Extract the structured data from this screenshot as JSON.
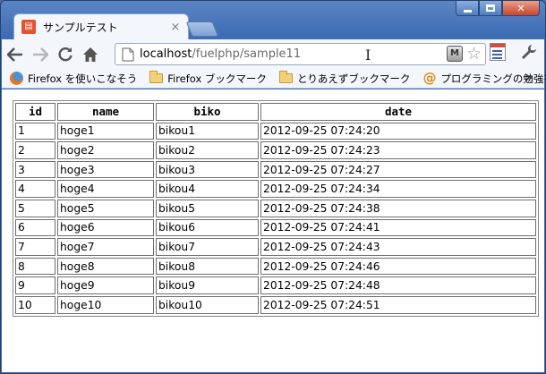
{
  "window": {
    "tab_title": "サンプルテスト",
    "tab_favicon_glyph": "▤",
    "tab_close_glyph": "×",
    "caption": {
      "minimize": "",
      "maximize": "",
      "close": "✕"
    }
  },
  "toolbar": {
    "url_host": "localhost",
    "url_path": "/fuelphp/sample11",
    "ext_label": "M",
    "star_glyph": "☆",
    "wrench_glyph": "🔧"
  },
  "bookmarks": {
    "items": [
      {
        "label": "Firefox を使いこなそう",
        "icon": "firefox-icon"
      },
      {
        "label": "Firefox ブックマーク",
        "icon": "folder-icon"
      },
      {
        "label": "とりあえずブックマーク",
        "icon": "folder-icon"
      },
      {
        "label": "プログラミングの勉強を…",
        "icon": "at-icon"
      }
    ],
    "more": "»"
  },
  "table": {
    "headers": [
      "id",
      "name",
      "biko",
      "date"
    ],
    "rows": [
      [
        "1",
        "hoge1",
        "bikou1",
        "2012-09-25 07:24:20"
      ],
      [
        "2",
        "hoge2",
        "bikou2",
        "2012-09-25 07:24:23"
      ],
      [
        "3",
        "hoge3",
        "bikou3",
        "2012-09-25 07:24:27"
      ],
      [
        "4",
        "hoge4",
        "bikou4",
        "2012-09-25 07:24:34"
      ],
      [
        "5",
        "hoge5",
        "bikou5",
        "2012-09-25 07:24:38"
      ],
      [
        "6",
        "hoge6",
        "bikou6",
        "2012-09-25 07:24:41"
      ],
      [
        "7",
        "hoge7",
        "bikou7",
        "2012-09-25 07:24:43"
      ],
      [
        "8",
        "hoge8",
        "bikou8",
        "2012-09-25 07:24:46"
      ],
      [
        "9",
        "hoge9",
        "bikou9",
        "2012-09-25 07:24:48"
      ],
      [
        "10",
        "hoge10",
        "bikou10",
        "2012-09-25 07:24:51"
      ]
    ]
  }
}
